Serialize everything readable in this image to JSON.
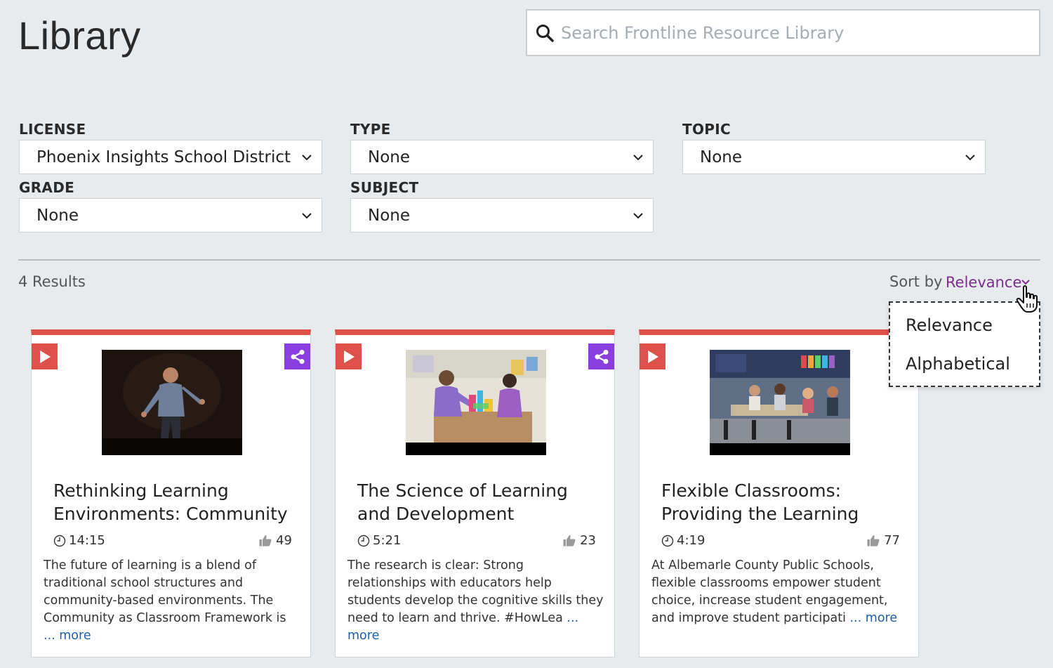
{
  "page": {
    "title": "Library"
  },
  "search": {
    "placeholder": "Search Frontline Resource Library",
    "value": ""
  },
  "filters": {
    "license": {
      "label": "LICENSE",
      "value": "Phoenix Insights School District"
    },
    "type": {
      "label": "TYPE",
      "value": "None"
    },
    "topic": {
      "label": "TOPIC",
      "value": "None"
    },
    "grade": {
      "label": "GRADE",
      "value": "None"
    },
    "subject": {
      "label": "SUBJECT",
      "value": "None"
    }
  },
  "results": {
    "count_label": "4 Results"
  },
  "sort": {
    "label": "Sort by",
    "value": "Relevance",
    "options": [
      "Relevance",
      "Alphabetical"
    ]
  },
  "colors": {
    "accent": "#e0504a",
    "share": "#8a3ee0",
    "sort": "#7b2d8b",
    "link": "#1f5fa8"
  },
  "cards": [
    {
      "title": "Rethinking Learning Environments: Community",
      "duration": "14:15",
      "likes": "49",
      "description": "The future of learning is a blend of traditional school structures and community-based environments. The Community as Classroom Framework is",
      "more": "... more",
      "shareable": true
    },
    {
      "title": "The Science of Learning and Development",
      "duration": "5:21",
      "likes": "23",
      "description": "The research is clear: Strong relationships with educators help students develop the cognitive skills they need to learn and thrive. #HowLea",
      "more": "... more",
      "shareable": true
    },
    {
      "title": "Flexible Classrooms: Providing the Learning",
      "duration": "4:19",
      "likes": "77",
      "description": "At Albemarle County Public Schools, flexible classrooms empower student choice, increase student engagement, and improve student participati",
      "more": "... more",
      "shareable": false
    }
  ]
}
